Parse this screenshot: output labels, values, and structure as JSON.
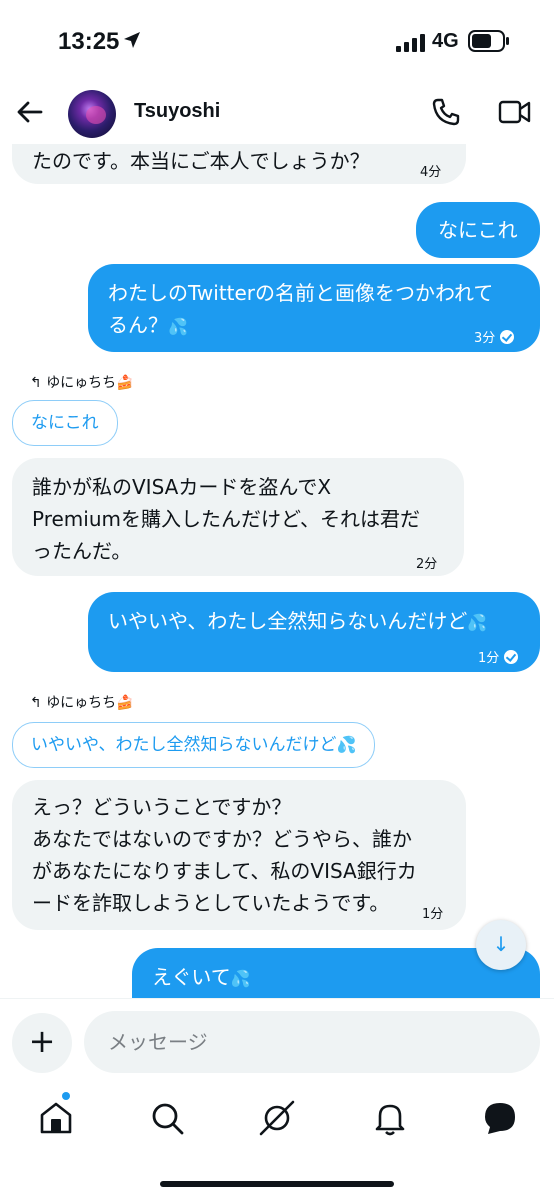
{
  "status": {
    "time": "13:25",
    "network": "4G"
  },
  "header": {
    "name": "Tsuyoshi"
  },
  "messages": [
    {
      "dir": "in",
      "text": "たのです。本当にご本人でしょうか？",
      "time": "4分"
    },
    {
      "dir": "out",
      "text": "なにこれ"
    },
    {
      "dir": "out",
      "line1": "わたしのTwitterの名前と画像をつかわれて",
      "line2": "るん？",
      "drop": "💦",
      "time": "3分"
    },
    {
      "dir": "in",
      "reply_to": "ゆにゅちち🍰",
      "quote": "なにこれ",
      "line1": "誰かが私のVISAカードを盗んでX",
      "line2": "Premiumを購入したんだけど、それは君だ",
      "line3": "ったんだ。",
      "time": "2分"
    },
    {
      "dir": "out",
      "text": "いやいや、わたし全然知らないんだけど",
      "drop": "💦",
      "time": "1分"
    },
    {
      "dir": "in",
      "reply_to": "ゆにゅちち🍰",
      "quote": "いやいや、わたし全然知らないんだけど",
      "quote_drop": "💦",
      "line1": "えっ？どういうことですか？",
      "line2": "あなたではないのですか？どうやら、誰か",
      "line3": "があなたになりすまして、私のVISA銀行カ",
      "line4": "ードを詐取しようとしていたようです。",
      "time": "1分"
    },
    {
      "dir": "out",
      "text": "えぐいて",
      "drop": "💦"
    }
  ],
  "composer": {
    "placeholder": "メッセージ"
  },
  "nav": [
    "home-icon",
    "search-icon",
    "grok-icon",
    "notifications-icon",
    "messages-icon"
  ],
  "colors": {
    "accent": "#1d9bf0",
    "incoming": "#eff3f4"
  }
}
